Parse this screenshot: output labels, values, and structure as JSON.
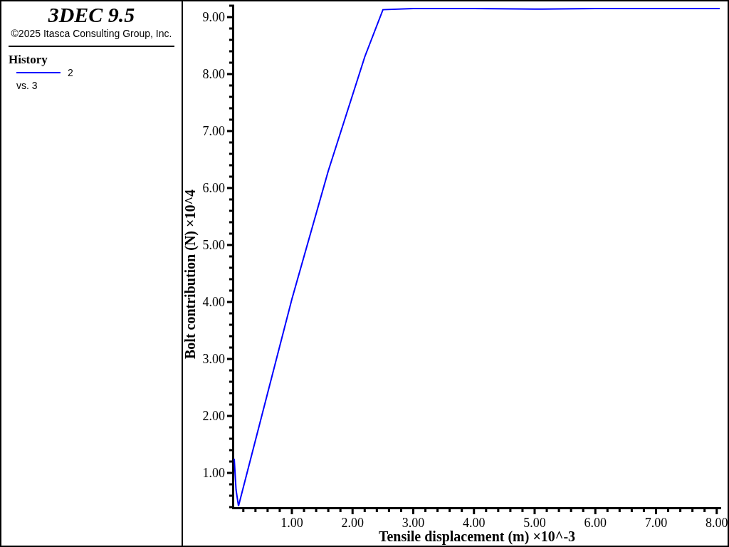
{
  "header": {
    "title": "3DEC 9.5",
    "copyright": "©2025 Itasca Consulting Group, Inc."
  },
  "legend": {
    "title": "History",
    "entries": [
      {
        "sublabel": "vs. 3"
      }
    ]
  },
  "plot": {
    "chart_data": {
      "type": "line",
      "xlabel": "Tensile displacement (m) ×10^-3",
      "ylabel": "Bolt contribution (N) ×10^4",
      "xlim": [
        0.05,
        8.05
      ],
      "ylim": [
        0.4,
        9.2
      ],
      "xticks": [
        {
          "value": 1,
          "label": "1.00"
        },
        {
          "value": 2,
          "label": "2.00"
        },
        {
          "value": 3,
          "label": "3.00"
        },
        {
          "value": 4,
          "label": "4.00"
        },
        {
          "value": 5,
          "label": "5.00"
        },
        {
          "value": 6,
          "label": "6.00"
        },
        {
          "value": 7,
          "label": "7.00"
        },
        {
          "value": 8,
          "label": "8.00"
        }
      ],
      "yticks": [
        {
          "value": 1,
          "label": "1.00"
        },
        {
          "value": 2,
          "label": "2.00"
        },
        {
          "value": 3,
          "label": "3.00"
        },
        {
          "value": 4,
          "label": "4.00"
        },
        {
          "value": 5,
          "label": "5.00"
        },
        {
          "value": 6,
          "label": "6.00"
        },
        {
          "value": 7,
          "label": "7.00"
        },
        {
          "value": 8,
          "label": "8.00"
        },
        {
          "value": 9,
          "label": "9.00"
        }
      ],
      "x": [
        0.05,
        0.08,
        0.12,
        0.6,
        1.0,
        1.6,
        2.2,
        2.5,
        3.0,
        4.0,
        5.0,
        6.0,
        7.0,
        8.05
      ],
      "series": [
        {
          "name": "2",
          "color": "#0000ff",
          "values": [
            1.25,
            0.7,
            0.42,
            2.4,
            4.05,
            6.3,
            8.3,
            9.13,
            9.15,
            9.15,
            9.14,
            9.15,
            9.15,
            9.15
          ]
        }
      ]
    }
  }
}
